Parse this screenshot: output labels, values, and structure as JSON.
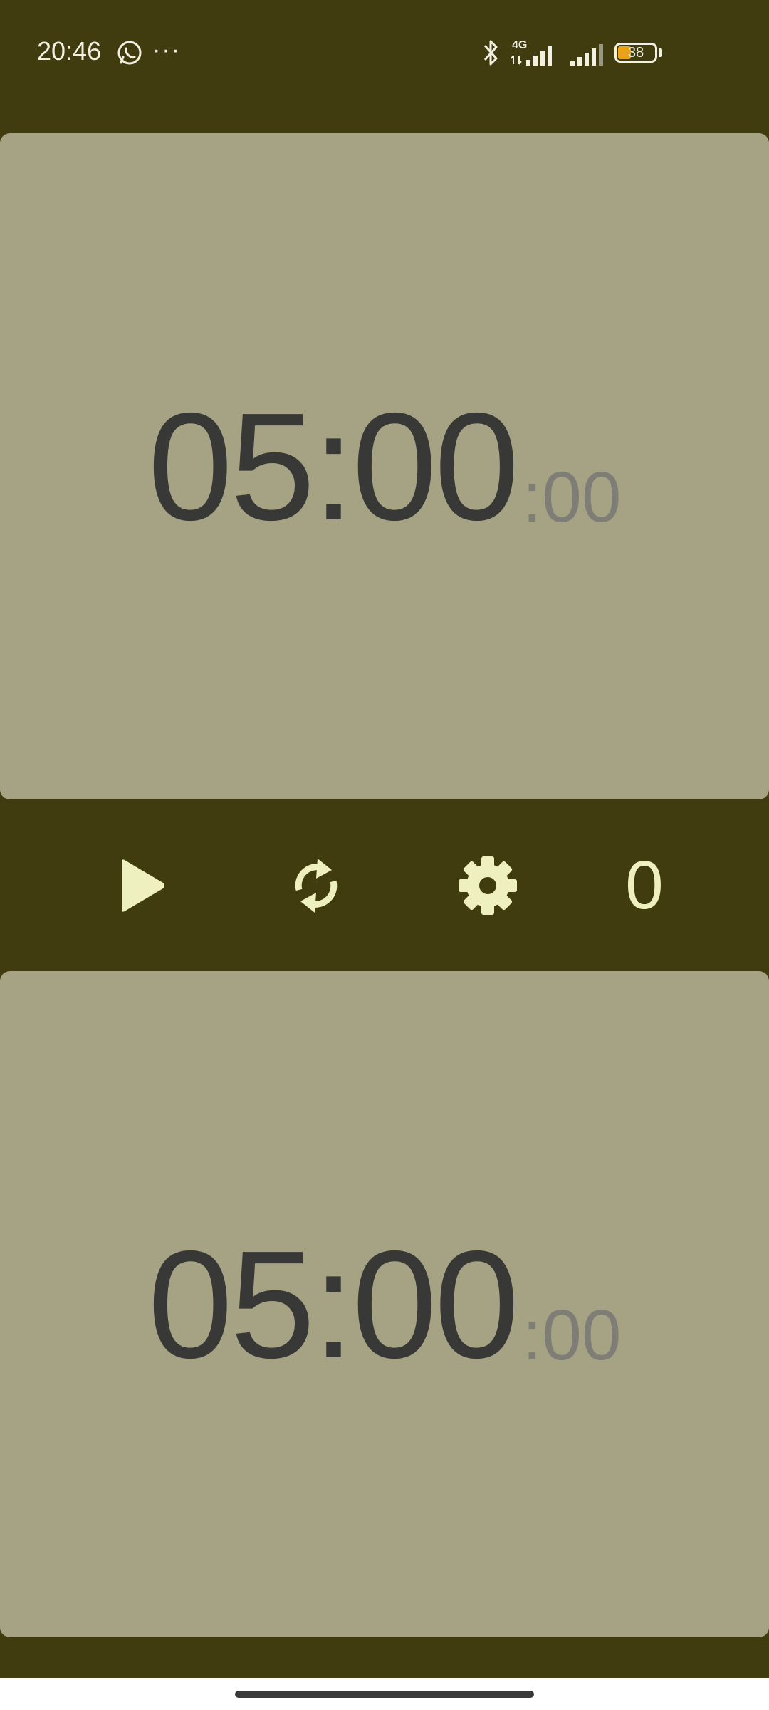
{
  "status_bar": {
    "time": "20:46",
    "more": "···",
    "network": "4G",
    "battery": "38",
    "battery_level": 0.38
  },
  "timer_top": {
    "main": "05:00",
    "sub": ":00"
  },
  "timer_bottom": {
    "main": "05:00",
    "sub": ":00"
  },
  "controls": {
    "play_icon": "play-icon",
    "reset_icon": "reset-icon",
    "settings_icon": "gear-icon",
    "count": "0"
  },
  "colors": {
    "background": "#403c10",
    "panel": "#a6a284",
    "accent": "#eef0c0"
  }
}
